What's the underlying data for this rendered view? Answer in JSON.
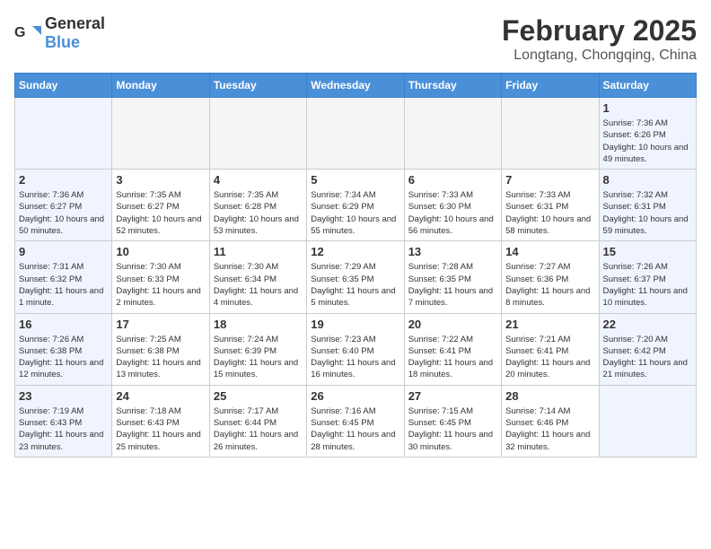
{
  "header": {
    "logo": {
      "general": "General",
      "blue": "Blue"
    },
    "title": "February 2025",
    "subtitle": "Longtang, Chongqing, China"
  },
  "weekdays": [
    "Sunday",
    "Monday",
    "Tuesday",
    "Wednesday",
    "Thursday",
    "Friday",
    "Saturday"
  ],
  "weeks": [
    [
      {
        "day": "",
        "empty": true
      },
      {
        "day": "",
        "empty": true
      },
      {
        "day": "",
        "empty": true
      },
      {
        "day": "",
        "empty": true
      },
      {
        "day": "",
        "empty": true
      },
      {
        "day": "",
        "empty": true
      },
      {
        "day": "1",
        "sunrise": "7:36 AM",
        "sunset": "6:26 PM",
        "daylight": "10 hours and 49 minutes."
      }
    ],
    [
      {
        "day": "2",
        "sunrise": "7:36 AM",
        "sunset": "6:27 PM",
        "daylight": "10 hours and 50 minutes."
      },
      {
        "day": "3",
        "sunrise": "7:35 AM",
        "sunset": "6:27 PM",
        "daylight": "10 hours and 52 minutes."
      },
      {
        "day": "4",
        "sunrise": "7:35 AM",
        "sunset": "6:28 PM",
        "daylight": "10 hours and 53 minutes."
      },
      {
        "day": "5",
        "sunrise": "7:34 AM",
        "sunset": "6:29 PM",
        "daylight": "10 hours and 55 minutes."
      },
      {
        "day": "6",
        "sunrise": "7:33 AM",
        "sunset": "6:30 PM",
        "daylight": "10 hours and 56 minutes."
      },
      {
        "day": "7",
        "sunrise": "7:33 AM",
        "sunset": "6:31 PM",
        "daylight": "10 hours and 58 minutes."
      },
      {
        "day": "8",
        "sunrise": "7:32 AM",
        "sunset": "6:31 PM",
        "daylight": "10 hours and 59 minutes."
      }
    ],
    [
      {
        "day": "9",
        "sunrise": "7:31 AM",
        "sunset": "6:32 PM",
        "daylight": "11 hours and 1 minute."
      },
      {
        "day": "10",
        "sunrise": "7:30 AM",
        "sunset": "6:33 PM",
        "daylight": "11 hours and 2 minutes."
      },
      {
        "day": "11",
        "sunrise": "7:30 AM",
        "sunset": "6:34 PM",
        "daylight": "11 hours and 4 minutes."
      },
      {
        "day": "12",
        "sunrise": "7:29 AM",
        "sunset": "6:35 PM",
        "daylight": "11 hours and 5 minutes."
      },
      {
        "day": "13",
        "sunrise": "7:28 AM",
        "sunset": "6:35 PM",
        "daylight": "11 hours and 7 minutes."
      },
      {
        "day": "14",
        "sunrise": "7:27 AM",
        "sunset": "6:36 PM",
        "daylight": "11 hours and 8 minutes."
      },
      {
        "day": "15",
        "sunrise": "7:26 AM",
        "sunset": "6:37 PM",
        "daylight": "11 hours and 10 minutes."
      }
    ],
    [
      {
        "day": "16",
        "sunrise": "7:26 AM",
        "sunset": "6:38 PM",
        "daylight": "11 hours and 12 minutes."
      },
      {
        "day": "17",
        "sunrise": "7:25 AM",
        "sunset": "6:38 PM",
        "daylight": "11 hours and 13 minutes."
      },
      {
        "day": "18",
        "sunrise": "7:24 AM",
        "sunset": "6:39 PM",
        "daylight": "11 hours and 15 minutes."
      },
      {
        "day": "19",
        "sunrise": "7:23 AM",
        "sunset": "6:40 PM",
        "daylight": "11 hours and 16 minutes."
      },
      {
        "day": "20",
        "sunrise": "7:22 AM",
        "sunset": "6:41 PM",
        "daylight": "11 hours and 18 minutes."
      },
      {
        "day": "21",
        "sunrise": "7:21 AM",
        "sunset": "6:41 PM",
        "daylight": "11 hours and 20 minutes."
      },
      {
        "day": "22",
        "sunrise": "7:20 AM",
        "sunset": "6:42 PM",
        "daylight": "11 hours and 21 minutes."
      }
    ],
    [
      {
        "day": "23",
        "sunrise": "7:19 AM",
        "sunset": "6:43 PM",
        "daylight": "11 hours and 23 minutes."
      },
      {
        "day": "24",
        "sunrise": "7:18 AM",
        "sunset": "6:43 PM",
        "daylight": "11 hours and 25 minutes."
      },
      {
        "day": "25",
        "sunrise": "7:17 AM",
        "sunset": "6:44 PM",
        "daylight": "11 hours and 26 minutes."
      },
      {
        "day": "26",
        "sunrise": "7:16 AM",
        "sunset": "6:45 PM",
        "daylight": "11 hours and 28 minutes."
      },
      {
        "day": "27",
        "sunrise": "7:15 AM",
        "sunset": "6:45 PM",
        "daylight": "11 hours and 30 minutes."
      },
      {
        "day": "28",
        "sunrise": "7:14 AM",
        "sunset": "6:46 PM",
        "daylight": "11 hours and 32 minutes."
      },
      {
        "day": "",
        "empty": true
      }
    ]
  ]
}
